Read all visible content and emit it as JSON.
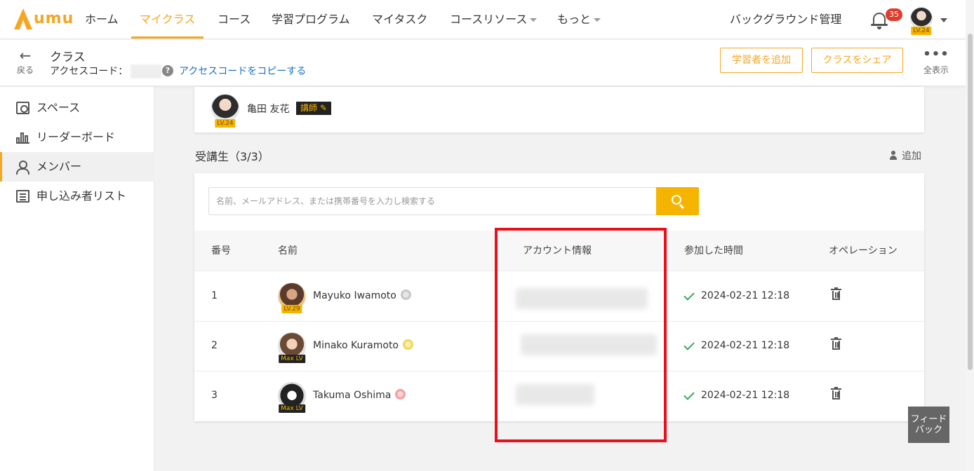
{
  "nav": {
    "logo_text": "umu",
    "items": [
      {
        "label": "ホーム"
      },
      {
        "label": "マイクラス"
      },
      {
        "label": "コース"
      },
      {
        "label": "学習プログラム"
      },
      {
        "label": "マイタスク"
      },
      {
        "label": "コースリソース"
      },
      {
        "label": "もっと"
      }
    ],
    "admin_label": "バックグラウンド管理",
    "notification_count": "35",
    "user_level": "LV.24"
  },
  "subheader": {
    "back_label": "戻る",
    "title": "クラス",
    "access_code_label": "アクセスコード：",
    "copy_link": "アクセスコードをコピーする",
    "add_learner_button": "学習者を追加",
    "share_button": "クラスをシェア",
    "more_label": "全表示"
  },
  "sidebar": {
    "items": [
      {
        "label": "スペース",
        "icon": "space-icon"
      },
      {
        "label": "リーダーボード",
        "icon": "leaderboard-icon"
      },
      {
        "label": "メンバー",
        "icon": "members-icon",
        "active": true
      },
      {
        "label": "申し込み者リスト",
        "icon": "list-icon"
      }
    ]
  },
  "teacher": {
    "name": "亀田 友花",
    "role": "講師",
    "level": "LV.24"
  },
  "students": {
    "title": "受講生（3/3）",
    "add_label": "追加",
    "search_placeholder": "名前、メールアドレス、または携帯番号を入力し検索する",
    "columns": [
      "番号",
      "名前",
      "アカウント情報",
      "参加した時間",
      "オペレーション"
    ],
    "rows": [
      {
        "no": "1",
        "name": "Mayuko Iwamoto",
        "level": "LV.29",
        "joined": "2024-02-21 12:18"
      },
      {
        "no": "2",
        "name": "Minako Kuramoto",
        "level": "Max LV",
        "joined": "2024-02-21 12:18"
      },
      {
        "no": "3",
        "name": "Takuma Oshima",
        "level": "Max LV",
        "joined": "2024-02-21 12:18"
      }
    ]
  },
  "feedback_label": "フィードバック",
  "colors": {
    "accent": "#f5a623",
    "highlight": "#e8101c",
    "link": "#1a73c8"
  }
}
